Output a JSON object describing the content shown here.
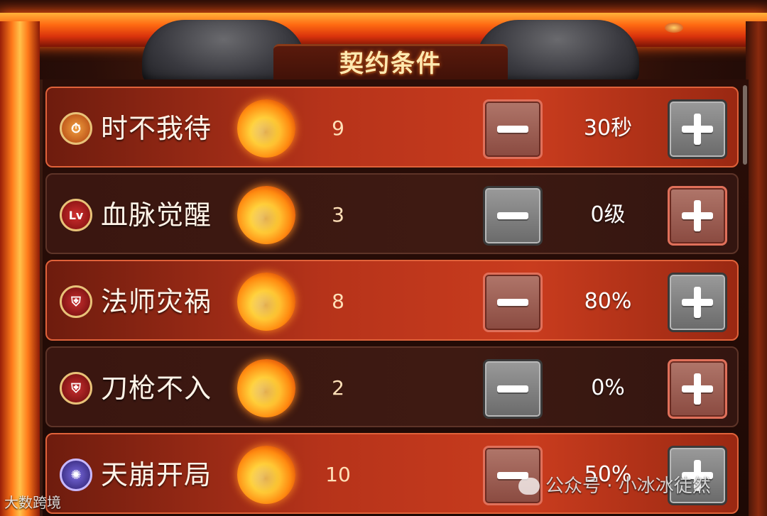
{
  "header": {
    "title": "契约条件"
  },
  "rows": [
    {
      "label": "时不我待",
      "icon": "clock-icon",
      "points": "9",
      "value": "30秒",
      "minus_active": true,
      "plus_active": false,
      "highlight": true
    },
    {
      "label": "血脉觉醒",
      "icon": "lv-badge-icon",
      "icon_text": "Lv",
      "points": "3",
      "value": "0级",
      "minus_active": false,
      "plus_active": true,
      "highlight": false
    },
    {
      "label": "法师灾祸",
      "icon": "shield-icon",
      "points": "8",
      "value": "80%",
      "minus_active": true,
      "plus_active": false,
      "highlight": true
    },
    {
      "label": "刀枪不入",
      "icon": "broken-shield-icon",
      "points": "2",
      "value": "0%",
      "minus_active": false,
      "plus_active": true,
      "highlight": false
    },
    {
      "label": "天崩开局",
      "icon": "purple-orb-icon",
      "points": "10",
      "value": "50%",
      "minus_active": true,
      "plus_active": false,
      "highlight": true
    }
  ],
  "watermarks": {
    "left": "大数跨境",
    "right": "公众号 · 小冰冰徒然"
  },
  "colors": {
    "active_row": "#c93c1e",
    "idle_row": "#3e1a12",
    "active_button": "#8a4a40",
    "idle_button": "#6a6a6a",
    "title_text": "#ffe9b0"
  }
}
